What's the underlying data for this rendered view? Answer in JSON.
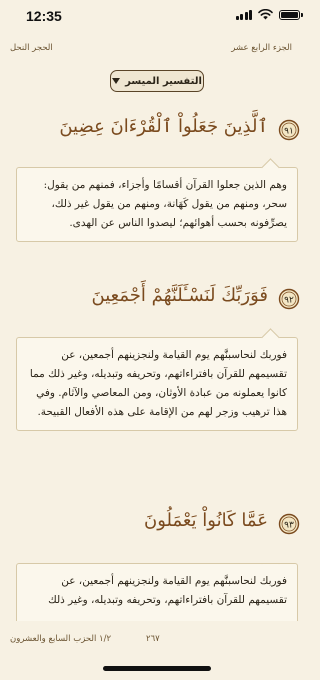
{
  "status_bar": {
    "time": "12:35"
  },
  "header": {
    "juz": "الجزء الرابع عشر",
    "surah": "الحجر النحل"
  },
  "tafsir_selector": {
    "label": "التفسير الميسر"
  },
  "ayat": [
    {
      "number": "٩١",
      "text": "ٱلَّذِينَ جَعَلُواْ ٱلْقُرْءَانَ عِضِينَ",
      "tafsir": "وهم الذين جعلوا القرآن أقسامًا وأجزاء، فمنهم من يقول: سحر، ومنهم من يقول كَهَانة، ومنهم من يقول غير ذلك، يصرِّفونه بحسب أهوائهم؛ ليصدوا الناس عن الهدى."
    },
    {
      "number": "٩٢",
      "text": "فَوَرَبِّكَ لَنَسْـَٔلَنَّهُمْ أَجْمَعِينَ",
      "tafsir": "فوربك لنحاسبنَّهم يوم القيامة ولنجزينهم أجمعين، عن تقسيمهم للقرآن بافتراءاتهم، وتحريفه وتبديله، وغير ذلك مما كانوا يعملونه من عبادة الأوثان، ومن المعاصي والآثام. وفي هذا ترهيب وزجر لهم من الإقامة على هذه الأفعال القبيحة."
    },
    {
      "number": "٩٣",
      "text": "عَمَّا كَانُواْ يَعْمَلُونَ",
      "tafsir": "فوربك لنحاسبنَّهم يوم القيامة ولنجزينهم أجمعين، عن تقسيمهم للقرآن بافتراءاتهم، وتحريفه وتبديله، وغير ذلك"
    }
  ],
  "footer": {
    "hizb": "١/٢ الحزب السابع والعشرون",
    "page": "٢٦٧"
  }
}
